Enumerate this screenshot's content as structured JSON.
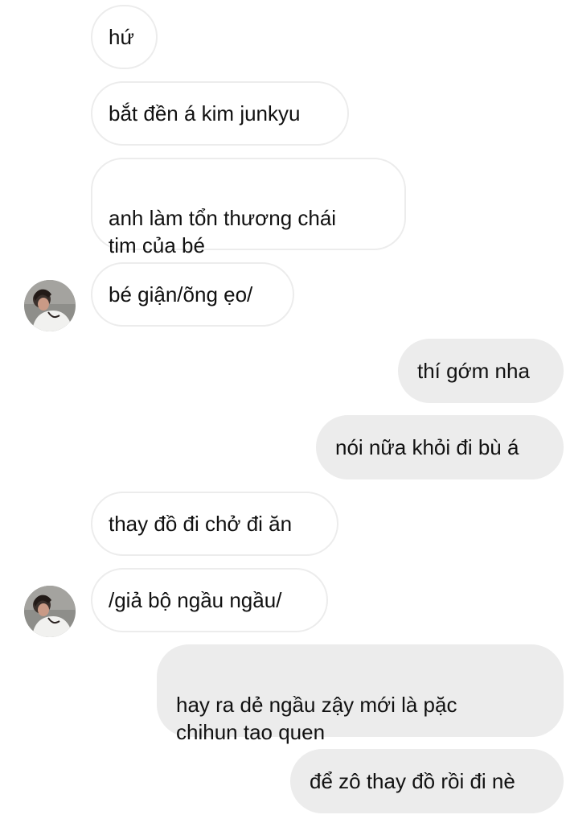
{
  "conversation": {
    "messages": [
      {
        "side": "in",
        "text": "hứ"
      },
      {
        "side": "in",
        "text": "bắt đền á kim junkyu"
      },
      {
        "side": "in",
        "text": "anh làm tổn thương chái\ntim của bé"
      },
      {
        "side": "in",
        "text": "bé giận/õng ẹo/"
      },
      {
        "side": "out",
        "text": "thí gớm nha"
      },
      {
        "side": "out",
        "text": "nói nữa khỏi đi bù á"
      },
      {
        "side": "in",
        "text": "thay đồ đi chở đi ăn"
      },
      {
        "side": "in",
        "text": "/giả bộ ngầu ngầu/"
      },
      {
        "side": "out",
        "text": "hay ra dẻ ngầu zậy mới là pặc\nchihun tao quen"
      },
      {
        "side": "out",
        "text": "để zô thay đồ rồi đi nè"
      }
    ],
    "avatar_icon": "contact-photo-avatar"
  },
  "colors": {
    "incoming_bubble_bg": "#ffffff",
    "incoming_bubble_border": "#ececec",
    "outgoing_bubble_bg": "#ececec",
    "text": "#111111"
  }
}
